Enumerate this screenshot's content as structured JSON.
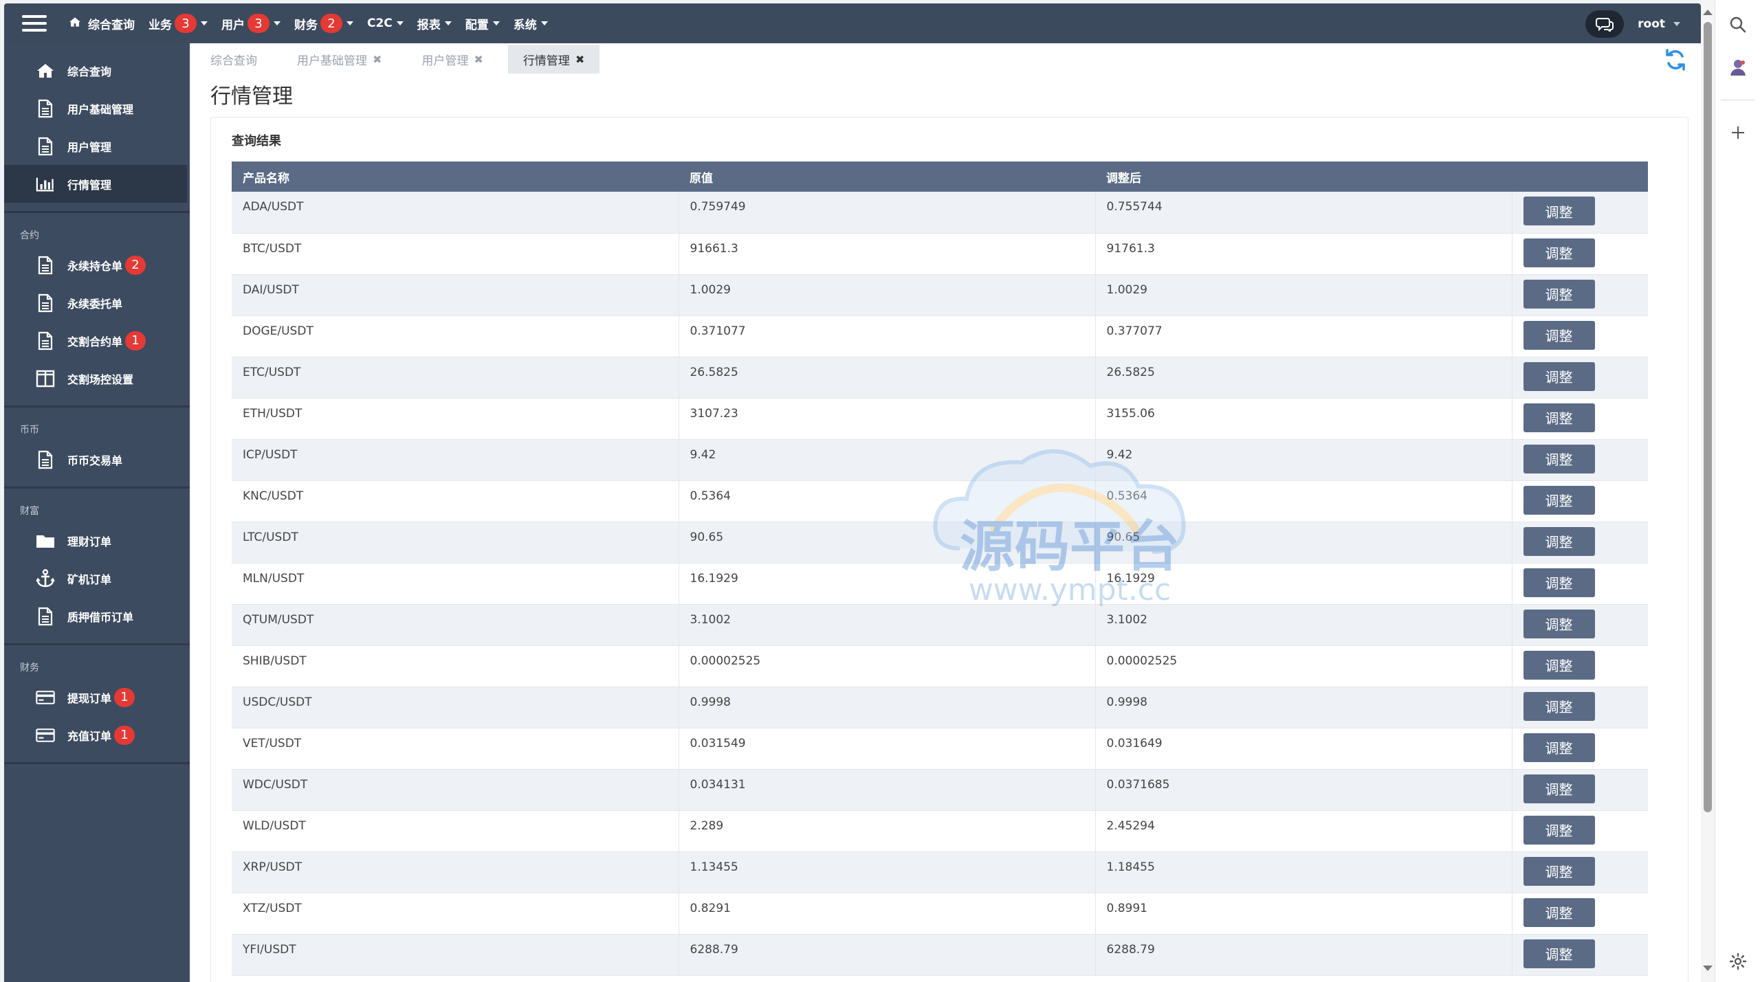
{
  "topbar": {
    "menu": [
      {
        "label": "综合查询",
        "has_home_icon": true,
        "has_caret": false
      },
      {
        "label": "业务",
        "badge": "3",
        "has_caret": true
      },
      {
        "label": "用户",
        "badge": "3",
        "has_caret": true
      },
      {
        "label": "财务",
        "badge": "2",
        "has_caret": true
      },
      {
        "label": "C2C",
        "has_caret": true
      },
      {
        "label": "报表",
        "has_caret": true
      },
      {
        "label": "配置",
        "has_caret": true
      },
      {
        "label": "系统",
        "has_caret": true
      }
    ],
    "user": "root"
  },
  "sidebar": {
    "top_items": [
      {
        "label": "综合查询",
        "icon": "home-icon"
      },
      {
        "label": "用户基础管理",
        "icon": "document-icon"
      },
      {
        "label": "用户管理",
        "icon": "document-icon"
      },
      {
        "label": "行情管理",
        "icon": "bar-chart-icon",
        "active": true
      }
    ],
    "groups": [
      {
        "title": "合约",
        "items": [
          {
            "label": "永续持仓单",
            "icon": "document-icon",
            "badge": "2"
          },
          {
            "label": "永续委托单",
            "icon": "document-icon"
          },
          {
            "label": "交割合约单",
            "icon": "document-icon",
            "badge": "1"
          },
          {
            "label": "交割场控设置",
            "icon": "columns-icon"
          }
        ]
      },
      {
        "title": "币币",
        "items": [
          {
            "label": "币币交易单",
            "icon": "document-icon"
          }
        ]
      },
      {
        "title": "财富",
        "items": [
          {
            "label": "理财订单",
            "icon": "folder-icon"
          },
          {
            "label": "矿机订单",
            "icon": "anchor-icon"
          },
          {
            "label": "质押借币订单",
            "icon": "document-icon"
          }
        ]
      },
      {
        "title": "财务",
        "items": [
          {
            "label": "提现订单",
            "icon": "credit-card-icon",
            "badge": "1"
          },
          {
            "label": "充值订单",
            "icon": "credit-card-icon",
            "badge": "1"
          }
        ]
      }
    ]
  },
  "tabs": [
    {
      "label": "综合查询",
      "closable": false,
      "active": false
    },
    {
      "label": "用户基础管理",
      "closable": true,
      "active": false
    },
    {
      "label": "用户管理",
      "closable": true,
      "active": false
    },
    {
      "label": "行情管理",
      "closable": true,
      "active": true
    }
  ],
  "page": {
    "title": "行情管理",
    "card_title": "查询结果"
  },
  "table": {
    "columns": [
      "产品名称",
      "原值",
      "调整后",
      ""
    ],
    "action_label": "调整",
    "rows": [
      {
        "name": "ADA/USDT",
        "original": "0.759749",
        "adjusted": "0.755744"
      },
      {
        "name": "BTC/USDT",
        "original": "91661.3",
        "adjusted": "91761.3"
      },
      {
        "name": "DAI/USDT",
        "original": "1.0029",
        "adjusted": "1.0029"
      },
      {
        "name": "DOGE/USDT",
        "original": "0.371077",
        "adjusted": "0.377077"
      },
      {
        "name": "ETC/USDT",
        "original": "26.5825",
        "adjusted": "26.5825"
      },
      {
        "name": "ETH/USDT",
        "original": "3107.23",
        "adjusted": "3155.06"
      },
      {
        "name": "ICP/USDT",
        "original": "9.42",
        "adjusted": "9.42"
      },
      {
        "name": "KNC/USDT",
        "original": "0.5364",
        "adjusted": "0.5364"
      },
      {
        "name": "LTC/USDT",
        "original": "90.65",
        "adjusted": "90.65"
      },
      {
        "name": "MLN/USDT",
        "original": "16.1929",
        "adjusted": "16.1929"
      },
      {
        "name": "QTUM/USDT",
        "original": "3.1002",
        "adjusted": "3.1002"
      },
      {
        "name": "SHIB/USDT",
        "original": "0.00002525",
        "adjusted": "0.00002525"
      },
      {
        "name": "USDC/USDT",
        "original": "0.9998",
        "adjusted": "0.9998"
      },
      {
        "name": "VET/USDT",
        "original": "0.031549",
        "adjusted": "0.031649"
      },
      {
        "name": "WDC/USDT",
        "original": "0.034131",
        "adjusted": "0.0371685"
      },
      {
        "name": "WLD/USDT",
        "original": "2.289",
        "adjusted": "2.45294"
      },
      {
        "name": "XRP/USDT",
        "original": "1.13455",
        "adjusted": "1.18455"
      },
      {
        "name": "XTZ/USDT",
        "original": "0.8291",
        "adjusted": "0.8991"
      },
      {
        "name": "YFI/USDT",
        "original": "6288.79",
        "adjusted": "6288.79"
      }
    ]
  },
  "watermark": {
    "brand": "源码平台",
    "url": "www.ympt.cc"
  },
  "colors": {
    "topbar": "#3c4a5e",
    "sidebar": "#3d4b60",
    "table_header": "#5b6b86",
    "badge": "#e53935",
    "refresh": "#2f8ee5"
  }
}
